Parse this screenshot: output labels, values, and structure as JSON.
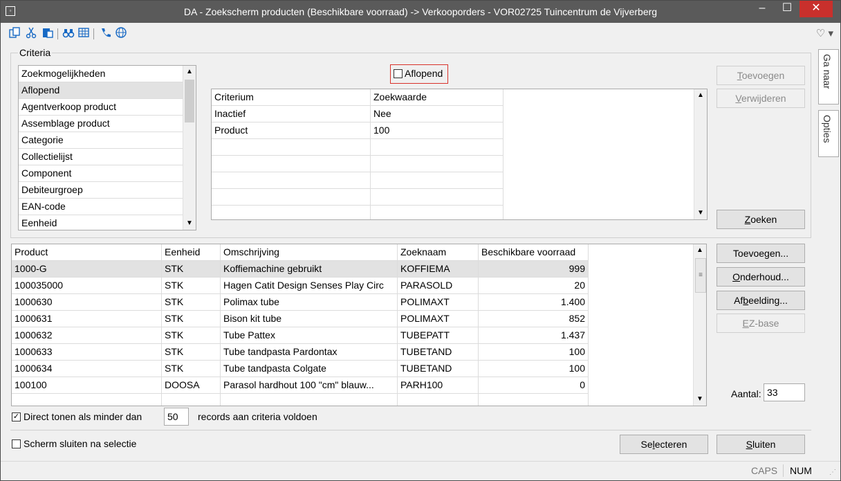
{
  "window": {
    "title": "DA - Zoekscherm producten (Beschikbare voorraad) -> Verkooporders - VOR02725 Tuincentrum de Vijverberg",
    "min_glyph": "–",
    "max_glyph": "☐",
    "close_glyph": "✕"
  },
  "toolbar": {
    "icons": [
      "copy-icon",
      "cut-icon",
      "paste-icon",
      "binoculars-icon",
      "grid-icon",
      "phone-icon",
      "globe-icon",
      "heart-icon"
    ]
  },
  "criteria": {
    "legend": "Criteria",
    "list": [
      "Zoekmogelijkheden",
      "Aflopend",
      "Agentverkoop product",
      "Assemblage product",
      "Categorie",
      "Collectielijst",
      "Component",
      "Debiteurgroep",
      "EAN-code",
      "Eenheid"
    ],
    "selected_index": 1,
    "checkbox_label": "Aflopend",
    "checkbox_checked": false,
    "grid_headers": [
      "Criterium",
      "Zoekwaarde"
    ],
    "grid_rows": [
      [
        "Inactief",
        "Nee"
      ],
      [
        "Product",
        "100"
      ]
    ],
    "buttons": {
      "add": "Toevoegen",
      "remove": "Verwijderen",
      "search": "Zoeken"
    }
  },
  "results": {
    "headers": [
      "Product",
      "Eenheid",
      "Omschrijving",
      "Zoeknaam",
      "Beschikbare voorraad"
    ],
    "rows": [
      [
        "1000-G",
        "STK",
        "Koffiemachine gebruikt",
        "KOFFIEMA",
        "999"
      ],
      [
        "100035000",
        "STK",
        "Hagen Catit Design Senses Play Circ",
        "PARASOLD",
        "20"
      ],
      [
        "1000630",
        "STK",
        "Polimax tube",
        "POLIMAXT",
        "1.400"
      ],
      [
        "1000631",
        "STK",
        "Bison kit tube",
        "POLIMAXT",
        "852"
      ],
      [
        "1000632",
        "STK",
        "Tube Pattex",
        "TUBEPATT",
        "1.437"
      ],
      [
        "1000633",
        "STK",
        "Tube tandpasta Pardontax",
        "TUBETAND",
        "100"
      ],
      [
        "1000634",
        "STK",
        "Tube tandpasta Colgate",
        "TUBETAND",
        "100"
      ],
      [
        "100100",
        "DOOSA",
        "Parasol hardhout 100 \"cm\" blauw...",
        "PARH100",
        "0"
      ]
    ],
    "selected_index": 0,
    "buttons": {
      "add": "Toevoegen...",
      "maintain": "Onderhoud...",
      "image": "Afbeelding...",
      "ezbase": "EZ-base"
    },
    "count_label": "Aantal:",
    "count_value": "33"
  },
  "footer": {
    "direct_checked": true,
    "direct_label": "Direct tonen als minder dan",
    "direct_value": "50",
    "direct_suffix": "records aan criteria voldoen",
    "close_after_checked": false,
    "close_after_label": "Scherm sluiten na selectie",
    "select_button": "Selecteren",
    "close_button": "Sluiten"
  },
  "sidetabs": {
    "goto": "Ga naar",
    "options": "Opties"
  },
  "statusbar": {
    "caps": "CAPS",
    "num": "NUM"
  }
}
